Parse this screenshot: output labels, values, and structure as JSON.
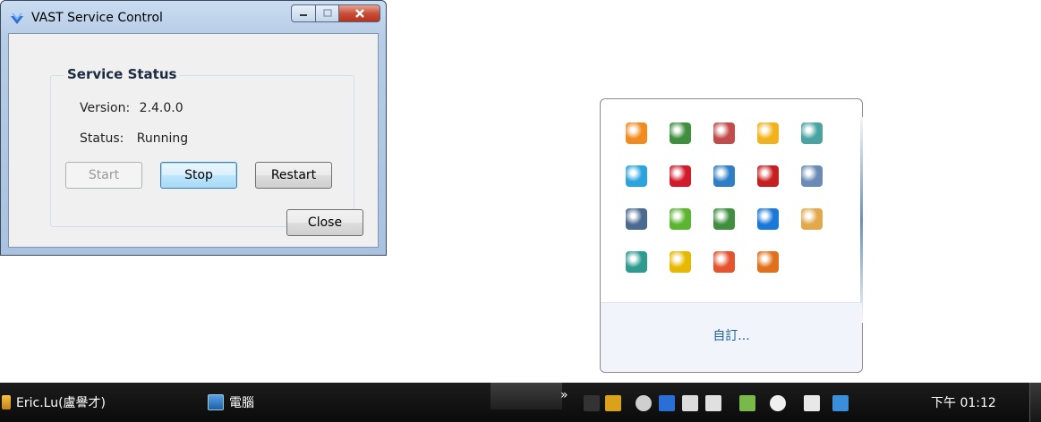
{
  "window": {
    "title": "VAST Service Control",
    "icon": "vast-logo-icon",
    "controls": {
      "minimize": "minimize-icon",
      "maximize": "maximize-icon",
      "close": "close-icon"
    },
    "group_title": "Service Status",
    "version_label": "Version:",
    "version_value": "2.4.0.0",
    "status_label": "Status:",
    "status_value": "Running",
    "buttons": {
      "start": "Start",
      "stop": "Stop",
      "restart": "Restart",
      "close": "Close"
    }
  },
  "tray_panel": {
    "icons": [
      {
        "name": "vlc-icon",
        "color": "#f28a1d"
      },
      {
        "name": "globe-green-icon",
        "color": "#3f8f3f"
      },
      {
        "name": "network-icon",
        "color": "#c24b4b"
      },
      {
        "name": "outlook-icon",
        "color": "#f2b21c"
      },
      {
        "name": "keyboard-mouse-icon",
        "color": "#4aa3a3"
      },
      {
        "name": "refresh-blue-icon",
        "color": "#2aa3df"
      },
      {
        "name": "kaspersky-icon",
        "color": "#d11a2a"
      },
      {
        "name": "hub-icon",
        "color": "#2f7fc6"
      },
      {
        "name": "adobe-icon",
        "color": "#c61f1f"
      },
      {
        "name": "drive-icon",
        "color": "#6a8bb5"
      },
      {
        "name": "document-sync-icon",
        "color": "#4a6a8f"
      },
      {
        "name": "evernote-icon",
        "color": "#5cb531"
      },
      {
        "name": "diamond-app-icon",
        "color": "#3f8f3f"
      },
      {
        "name": "teamviewer-icon",
        "color": "#1a79d8"
      },
      {
        "name": "network-settings-icon",
        "color": "#e2a84a"
      },
      {
        "name": "sync-globe-icon",
        "color": "#2e9b8f"
      },
      {
        "name": "shield-icon",
        "color": "#e6b800"
      },
      {
        "name": "color-wheel-icon",
        "color": "#e5532f"
      },
      {
        "name": "java-icon",
        "color": "#e0701b"
      }
    ],
    "footer_link": "自訂..."
  },
  "taskbar": {
    "user_label": "Eric.Lu(盧譽才)",
    "computer_label": "電腦",
    "clock": "下午 01:12",
    "tray_icons": [
      "show-hidden-icon",
      "pdf-icon",
      "keyboard-icon",
      "help-icon",
      "pin-icon",
      "display-icon",
      "network-icon",
      "flag-icon",
      "volume-icon",
      "dropbox-icon",
      "network-error-icon"
    ]
  },
  "colors": {
    "taskbar_bg": "#121212",
    "link": "#1c5fa8",
    "window_frame": "#b7cde6"
  }
}
